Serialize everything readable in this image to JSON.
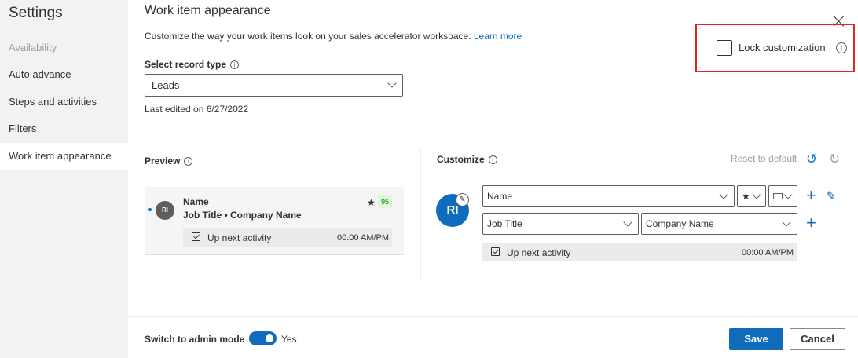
{
  "sidebar": {
    "title": "Settings",
    "items": [
      {
        "label": "Availability",
        "state": "disabled"
      },
      {
        "label": "Auto advance",
        "state": "normal"
      },
      {
        "label": "Steps and activities",
        "state": "normal"
      },
      {
        "label": "Filters",
        "state": "normal"
      },
      {
        "label": "Work item appearance",
        "state": "active"
      }
    ]
  },
  "main": {
    "title": "Work item appearance",
    "description": "Customize the way your work items look on your sales accelerator workspace.",
    "learn_more": "Learn more",
    "record_type_label": "Select record type",
    "record_type_value": "Leads",
    "last_edited": "Last edited on 6/27/2022",
    "lock_label": "Lock customization",
    "lock_checked": false
  },
  "preview": {
    "label": "Preview",
    "avatar_initials": "RI",
    "name": "Name",
    "subtitle": "Job Title • Company Name",
    "star": "★",
    "score": "95",
    "activity": "Up next activity",
    "time": "00:00 AM/PM"
  },
  "customize": {
    "label": "Customize",
    "reset": "Reset to default",
    "avatar_initials": "RI",
    "field_name": "Name",
    "field_star": "★",
    "field_job": "Job Title",
    "field_company": "Company Name",
    "activity": "Up next activity",
    "time": "00:00 AM/PM"
  },
  "footer": {
    "admin_label": "Switch to admin mode",
    "admin_value": "Yes",
    "save": "Save",
    "cancel": "Cancel"
  },
  "colors": {
    "accent": "#0f6cbd",
    "highlight": "#e1251b",
    "score_bg": "#dff6dd"
  }
}
